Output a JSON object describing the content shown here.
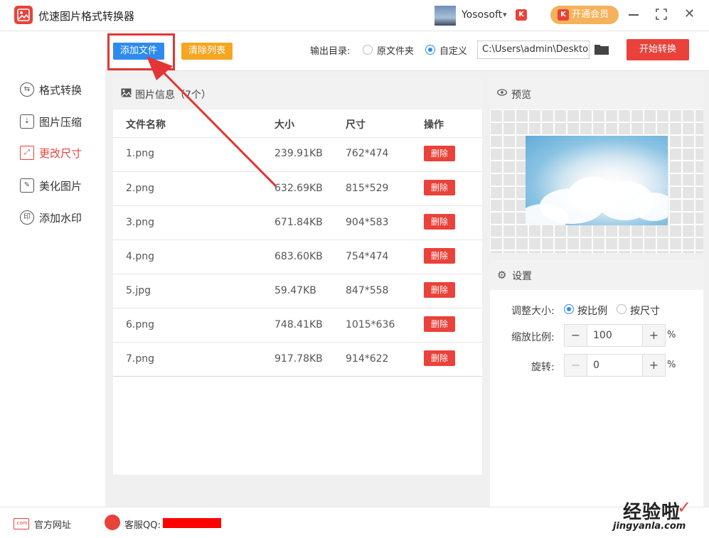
{
  "app": {
    "title": "优速图片格式转换器",
    "user": "Yososoft",
    "vip_label": "开通会员",
    "vip_mini": "K"
  },
  "sidebar": {
    "items": [
      {
        "label": "格式转换",
        "active": false
      },
      {
        "label": "图片压缩",
        "active": false
      },
      {
        "label": "更改尺寸",
        "active": true
      },
      {
        "label": "美化图片",
        "active": false
      },
      {
        "label": "添加水印",
        "active": false
      }
    ]
  },
  "toolbar": {
    "add_label": "添加文件",
    "clear_label": "清除列表",
    "output_label": "输出目录:",
    "option_original": "原文件夹",
    "option_custom": "自定义",
    "path": "C:\\Users\\admin\\Deskto",
    "start_label": "开始转换"
  },
  "list": {
    "title": "图片信息（7个）",
    "headers": {
      "name": "文件名称",
      "size": "大小",
      "dims": "尺寸",
      "action": "操作"
    },
    "rows": [
      {
        "name": "1.png",
        "size": "239.91KB",
        "dims": "762*474",
        "action": "删除"
      },
      {
        "name": "2.png",
        "size": "632.69KB",
        "dims": "815*529",
        "action": "删除"
      },
      {
        "name": "3.png",
        "size": "671.84KB",
        "dims": "904*583",
        "action": "删除"
      },
      {
        "name": "4.png",
        "size": "683.60KB",
        "dims": "754*474",
        "action": "删除"
      },
      {
        "name": "5.jpg",
        "size": "59.47KB",
        "dims": "847*558",
        "action": "删除"
      },
      {
        "name": "6.png",
        "size": "748.41KB",
        "dims": "1015*636",
        "action": "删除"
      },
      {
        "name": "7.png",
        "size": "917.78KB",
        "dims": "914*622",
        "action": "删除"
      }
    ]
  },
  "preview": {
    "title": "预览"
  },
  "settings": {
    "title": "设置",
    "resize_label": "调整大小:",
    "by_ratio": "按比例",
    "by_size": "按尺寸",
    "scale_label": "缩放比例:",
    "scale_value": "100",
    "rotate_label": "旋转:",
    "rotate_value": "0",
    "minus": "−",
    "plus": "+",
    "percent": "%"
  },
  "footer": {
    "website": "官方网址",
    "qq": "客服QQ:",
    "web_icon": ".com"
  },
  "watermark": {
    "main": "经验啦",
    "check": "✓",
    "sub": "jingyanla.com"
  },
  "colors": {
    "accent": "#e9423a",
    "primary": "#2e8bed",
    "orange": "#f5a623",
    "vip": "#f5b25a"
  }
}
